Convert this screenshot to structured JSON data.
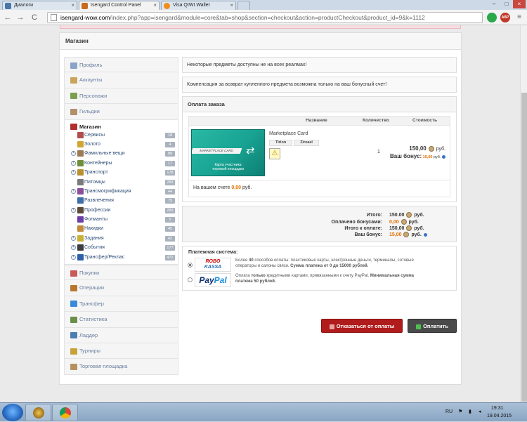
{
  "browser": {
    "tabs": [
      {
        "label": "Диалоги",
        "color": "#4a76a8",
        "active": false
      },
      {
        "label": "Isengard Control Panel",
        "color": "#c86b1f",
        "active": true
      },
      {
        "label": "Visa QIWI Wallet",
        "color": "#f28c1a",
        "active": false
      }
    ],
    "url_host": "isengard-wow.com",
    "url_path": "/index.php?app=isengard&module=core&tab=shop&section=checkout&action=productCheckout&product_id=9&k=1112",
    "nav": {
      "back": "←",
      "forward": "→",
      "reload": "C"
    },
    "ext_abp": "ABP"
  },
  "card_title": "Магазин",
  "sidebar": {
    "top_items": [
      {
        "label": "Профиль",
        "icon": "profile-icon",
        "color": "#8aa3c8"
      },
      {
        "label": "Аккаунты",
        "icon": "accounts-icon",
        "color": "#c9a45a"
      },
      {
        "label": "Персонажи",
        "icon": "characters-icon",
        "color": "#7a9f4f"
      },
      {
        "label": "Гильдии",
        "icon": "guilds-icon",
        "color": "#b0916b"
      }
    ],
    "shop": {
      "title": "Магазин",
      "icon_color": "#b03030",
      "subitems": [
        {
          "label": "Сервисы",
          "count": "18",
          "expand": false,
          "color": "#b04e4e"
        },
        {
          "label": "Золото",
          "count": "4",
          "expand": false,
          "color": "#d2a536"
        },
        {
          "label": "Фамильные вещи",
          "count": "89",
          "expand": true,
          "color": "#9a7b55"
        },
        {
          "label": "Контейнеры",
          "count": "17",
          "expand": true,
          "color": "#6e8f3a"
        },
        {
          "label": "Транспорт",
          "count": "178",
          "expand": true,
          "color": "#b8922f"
        },
        {
          "label": "Питомцы",
          "count": "283",
          "expand": false,
          "color": "#7a7a7a"
        },
        {
          "label": "Трансмогрификация",
          "count": "44",
          "expand": true,
          "color": "#8a4f9b"
        },
        {
          "label": "Развлечения",
          "count": "75",
          "expand": false,
          "color": "#3f6fa6"
        },
        {
          "label": "Профессии",
          "count": "283",
          "expand": true,
          "color": "#5b4a3a"
        },
        {
          "label": "Фолианты",
          "count": "5",
          "expand": false,
          "color": "#6b3ea8"
        },
        {
          "label": "Накидки",
          "count": "45",
          "expand": false,
          "color": "#c08a3a"
        },
        {
          "label": "Задания",
          "count": "42",
          "expand": true,
          "color": "#c9b037"
        },
        {
          "label": "События",
          "count": "177",
          "expand": true,
          "color": "#3e3e3e"
        },
        {
          "label": "Трансфер/Реклас",
          "count": "472",
          "expand": true,
          "color": "#2e5fa8"
        }
      ]
    },
    "bottom_items": [
      {
        "label": "Покупки",
        "icon": "purchases-icon",
        "color": "#c85a5a"
      },
      {
        "label": "Операции",
        "icon": "operations-icon",
        "color": "#b8762f"
      },
      {
        "label": "Трансфер",
        "icon": "transfer-icon",
        "color": "#3b8ad8"
      },
      {
        "label": "Статистика",
        "icon": "statistics-icon",
        "color": "#6a8f4a"
      },
      {
        "label": "Ладдер",
        "icon": "ladder-icon",
        "color": "#4a7fb0"
      },
      {
        "label": "Турниры",
        "icon": "tournaments-icon",
        "color": "#c7a13a"
      },
      {
        "label": "Торговая площадка",
        "icon": "marketplace-icon",
        "color": "#b89060"
      }
    ]
  },
  "notices": [
    "Некоторые предметы доступны не на всех реалмах!",
    "Компенсация за возврат купленного предмета возможна только на ваш бонусный счет!"
  ],
  "order": {
    "title": "Оплата заказа",
    "headers": {
      "name": "Название",
      "qty": "Количество",
      "cost": "Стоимость"
    },
    "product": {
      "name": "Marketplace Card",
      "image_band": "MARKETPLACE CARD",
      "image_caption_1": "Карта участника",
      "image_caption_2": "торговой площадки",
      "realms": [
        "Tirion",
        "Zireael"
      ],
      "qty": "1",
      "price": "150,00",
      "currency": "руб.",
      "bonus_label": "Ваш бонус:",
      "bonus_value": "15,00",
      "bonus_currency": "руб."
    },
    "balance_label": "На вашем счете",
    "balance_value": "0,00",
    "balance_currency": "руб."
  },
  "totals": {
    "rows": [
      {
        "label": "Итого:",
        "value": "150.00",
        "currency": "руб.",
        "orange": false
      },
      {
        "label": "Оплачено бонусами:",
        "value": "0,00",
        "currency": "руб.",
        "orange": true
      },
      {
        "label": "Итого к оплате:",
        "value": "150,00",
        "currency": "руб.",
        "orange": false
      },
      {
        "label": "Ваш бонус:",
        "value": "15,00",
        "currency": "руб.",
        "orange": true
      }
    ]
  },
  "payment": {
    "title": "Платежная система:",
    "options": [
      {
        "logo_1": "ROBO",
        "logo_2": "KASSA",
        "text_1": "Более ",
        "text_bold_1": "40",
        "text_2": " способов оплаты: пластиковые карты, электронные деньги, терминалы, сотовые операторы и салоны связи. ",
        "text_bold_2": "Сумма платежа от 0 до 15000 рублей.",
        "selected": true
      },
      {
        "logo_1": "Pay",
        "logo_2": "Pal",
        "text_1": "Оплата ",
        "text_bold_1": "только",
        "text_2": " кредитными картами, привязанными к счету PayPal. ",
        "text_bold_2": "Минимальная сумма платежа 50 рублей.",
        "selected": false
      }
    ],
    "cancel_label": "Отказаться от оплаты",
    "pay_label": "Оплатить"
  },
  "taskbar": {
    "lang": "RU",
    "time": "19:31",
    "date": "19.04.2015"
  }
}
